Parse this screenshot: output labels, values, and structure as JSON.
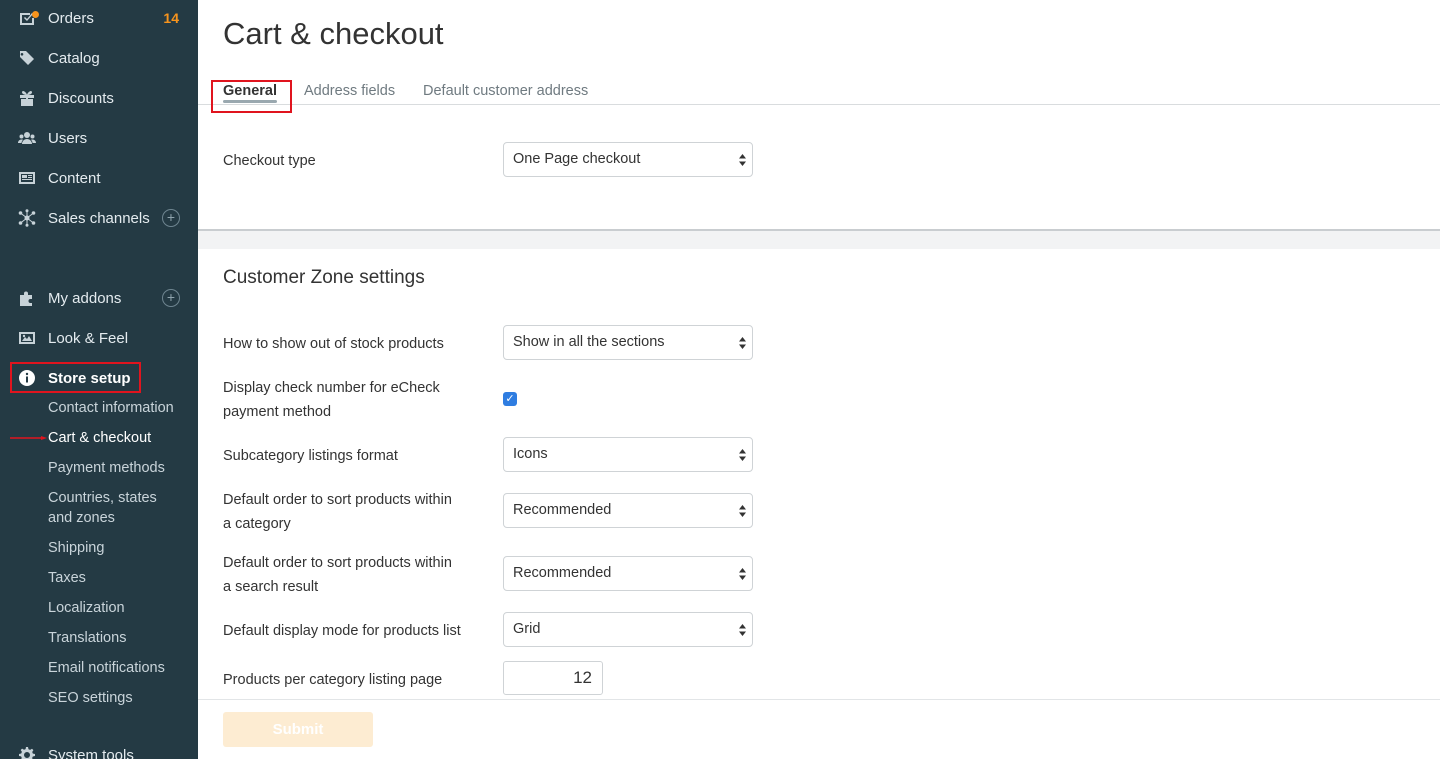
{
  "sidebar": {
    "items": [
      {
        "label": "Orders",
        "icon": "orders-icon",
        "badge": "14"
      },
      {
        "label": "Catalog",
        "icon": "tags-icon"
      },
      {
        "label": "Discounts",
        "icon": "gift-icon"
      },
      {
        "label": "Users",
        "icon": "users-icon"
      },
      {
        "label": "Content",
        "icon": "content-icon"
      },
      {
        "label": "Sales channels",
        "icon": "network-icon"
      },
      {
        "label": "My addons",
        "icon": "puzzle-icon"
      },
      {
        "label": "Look & Feel",
        "icon": "image-icon"
      },
      {
        "label": "Store setup",
        "icon": "info-icon"
      },
      {
        "label": "System tools",
        "icon": "gear-icon"
      }
    ],
    "store_setup_subitems": [
      "Contact information",
      "Cart & checkout",
      "Payment methods",
      "Countries, states",
      "and zones",
      "Shipping",
      "Taxes",
      "Localization",
      "Translations",
      "Email notifications",
      "SEO settings"
    ],
    "plus_symbol": "+"
  },
  "page": {
    "title": "Cart & checkout",
    "tabs": [
      "General",
      "Address fields",
      "Default customer address"
    ],
    "general": {
      "checkout_type_label": "Checkout type",
      "checkout_type_value": "One Page checkout"
    },
    "customer_zone": {
      "title": "Customer Zone settings",
      "out_of_stock_label": "How to show out of stock products",
      "out_of_stock_value": "Show in all the sections",
      "echeck_label_1": "Display check number for eCheck",
      "echeck_label_2": "payment method",
      "echeck_checked": "✓",
      "subcategory_label": "Subcategory listings format",
      "subcategory_value": "Icons",
      "sort_category_label_1": "Default order to sort products within",
      "sort_category_label_2": "a category",
      "sort_category_value": "Recommended",
      "sort_search_label_1": "Default order to sort products within",
      "sort_search_label_2": "a search result",
      "sort_search_value": "Recommended",
      "display_mode_label": "Default display mode for products list",
      "display_mode_value": "Grid",
      "per_page_label": "Products per category listing page",
      "per_page_value": "12"
    },
    "submit_label": "Submit"
  },
  "colors": {
    "sidebar_bg": "#243a44",
    "badge": "#f7941d",
    "highlight": "#e0141e",
    "checkbox": "#2f7de1",
    "submit_bg": "#fdecd2"
  }
}
